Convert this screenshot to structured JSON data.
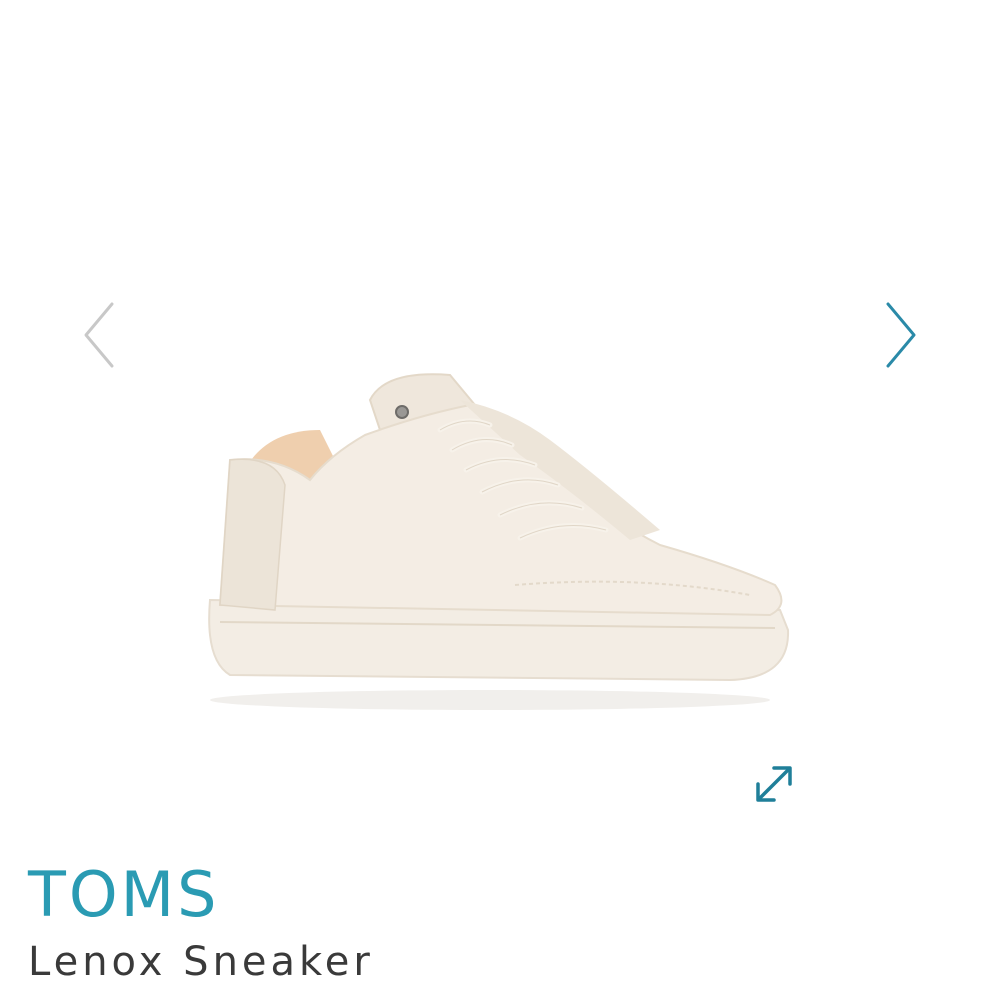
{
  "gallery": {
    "prev_icon": "chevron-left-icon",
    "next_icon": "chevron-right-icon",
    "expand_icon": "expand-arrows-icon",
    "image_subject": "white low-top lace-up sneaker"
  },
  "product": {
    "brand": "TOMS",
    "name": "Lenox Sneaker"
  },
  "colors": {
    "brand": "#2a9bb3",
    "prev_arrow": "#c8c8c8",
    "next_arrow": "#2a8aa8",
    "expand_icon": "#1f7f99"
  }
}
